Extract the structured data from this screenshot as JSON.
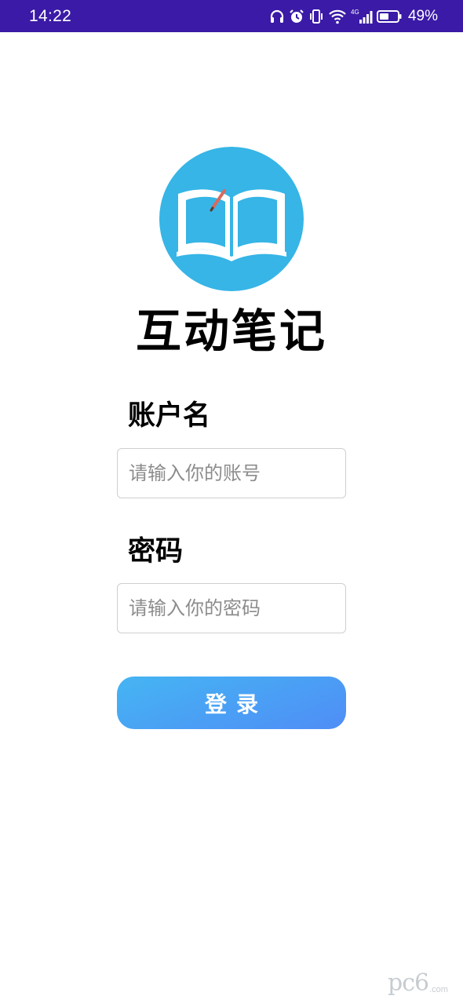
{
  "status_bar": {
    "time": "14:22",
    "battery_percent": "49%",
    "network_label": "4G",
    "icons": [
      "headphones-icon",
      "alarm-icon",
      "vibrate-icon",
      "wifi-icon",
      "signal-icon",
      "battery-icon"
    ],
    "background": "#3a1aa6"
  },
  "app": {
    "title": "互动笔记",
    "logo_icon": "open-book-icon",
    "logo_color": "#36b5e6"
  },
  "form": {
    "account_label": "账户名",
    "account_placeholder": "请输入你的账号",
    "account_value": "",
    "password_label": "密码",
    "password_placeholder": "请输入你的密码",
    "password_value": "",
    "login_label": "登录",
    "login_colors": [
      "#45b5f3",
      "#4f8df6"
    ]
  },
  "watermark": {
    "text": "pc6",
    "sub": ".com"
  }
}
